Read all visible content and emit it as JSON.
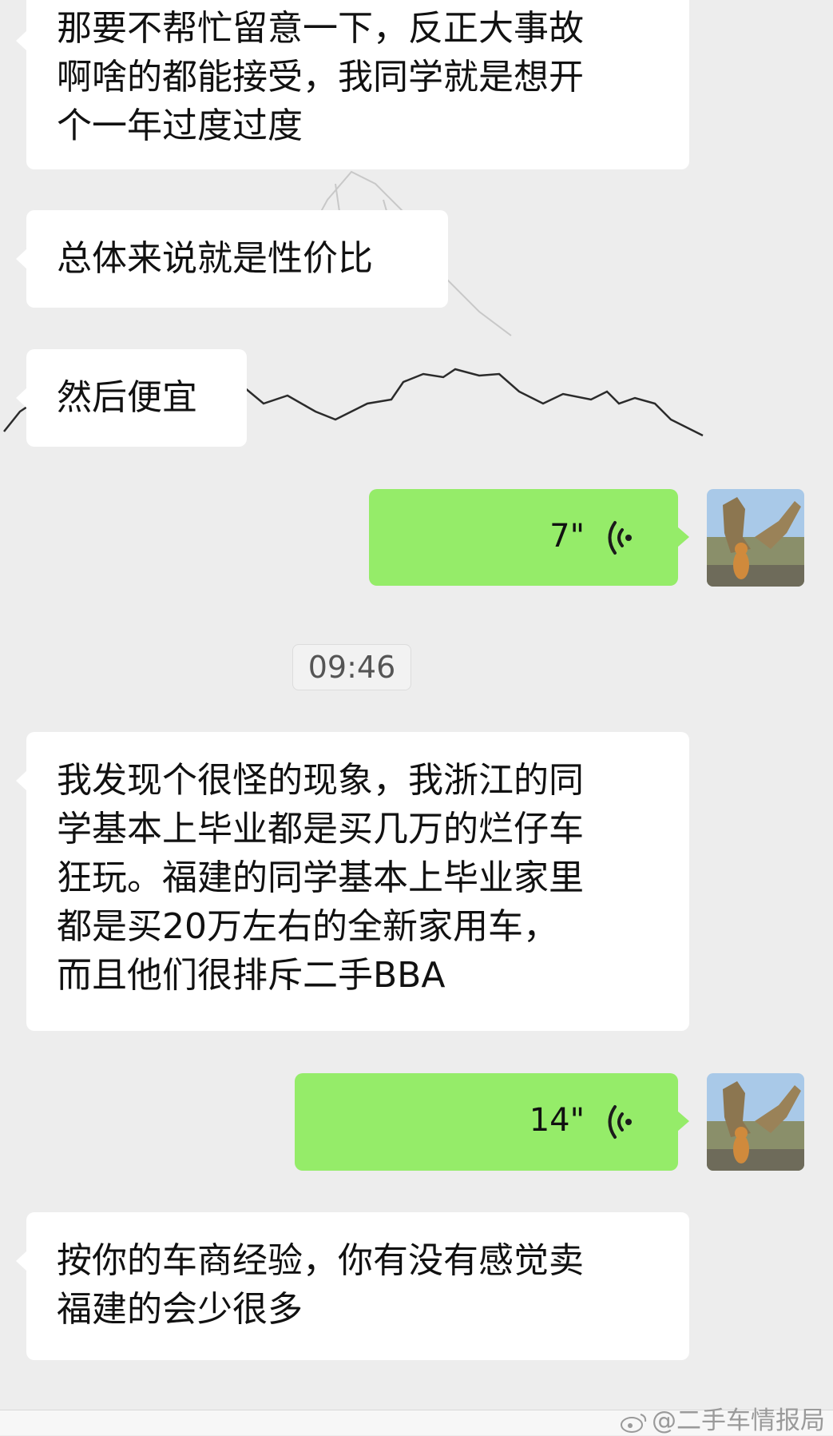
{
  "messages": [
    {
      "side": "in",
      "text": "那要不帮忙留意一下，反正大事故\n啊啥的都能接受，我同学就是想开\n个一年过度过度"
    },
    {
      "side": "in",
      "text": "总体来说就是性价比"
    },
    {
      "side": "in",
      "text": "然后便宜"
    },
    {
      "side": "out",
      "type": "voice",
      "duration": "7\""
    },
    {
      "side": "in",
      "text": "我发现个很怪的现象，我浙江的同\n学基本上毕业都是买几万的烂仔车\n狂玩。福建的同学基本上毕业家里\n都是买20万左右的全新家用车，\n而且他们很排斥二手BBA"
    },
    {
      "side": "out",
      "type": "voice",
      "duration": "14\""
    },
    {
      "side": "in",
      "text": "按你的车商经验，你有没有感觉卖\n福建的会少很多"
    }
  ],
  "timestamp": "09:46",
  "watermark": "@二手车情报局",
  "colors": {
    "outgoing": "#95ec69",
    "incoming": "#ffffff",
    "background": "#ededed"
  }
}
